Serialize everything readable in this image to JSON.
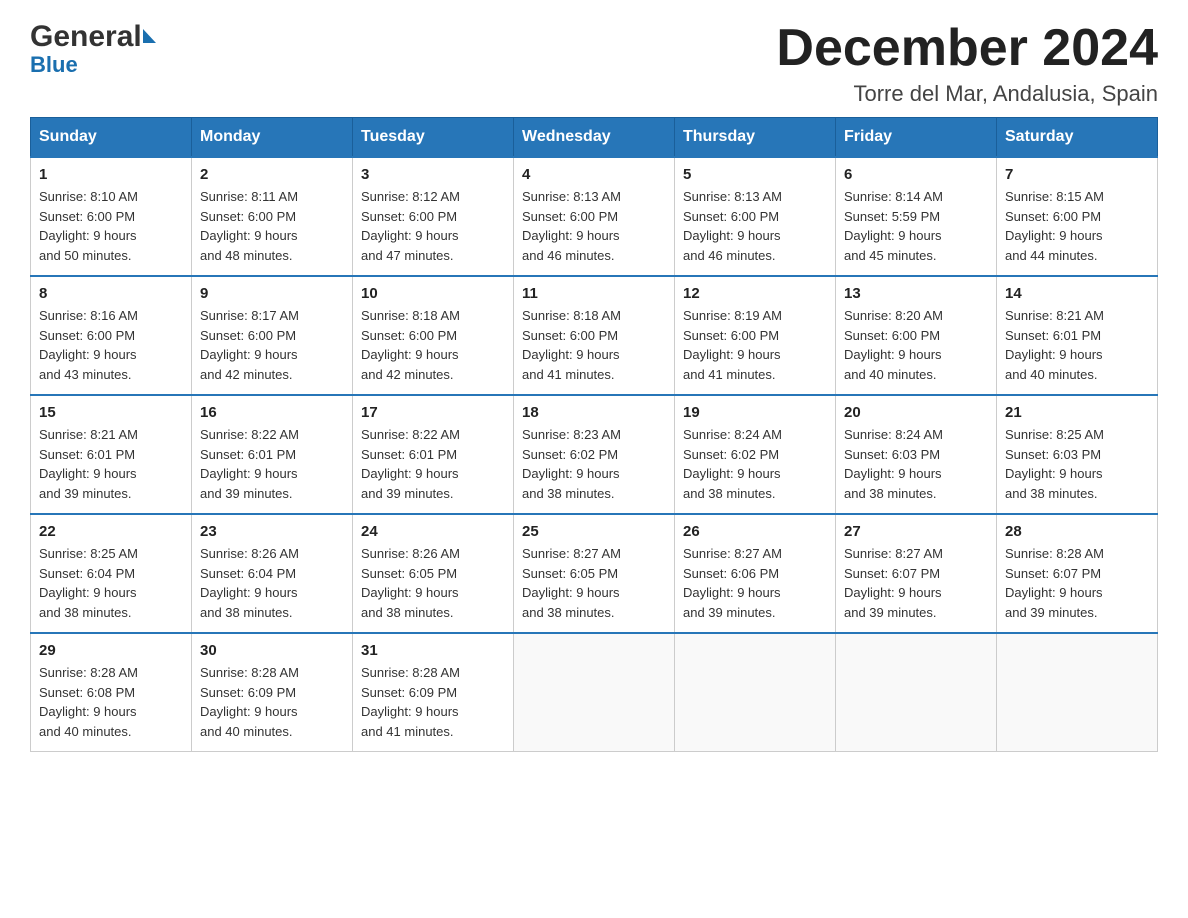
{
  "logo": {
    "general": "General",
    "blue": "Blue",
    "arrow": "▶"
  },
  "title": "December 2024",
  "subtitle": "Torre del Mar, Andalusia, Spain",
  "days_of_week": [
    "Sunday",
    "Monday",
    "Tuesday",
    "Wednesday",
    "Thursday",
    "Friday",
    "Saturday"
  ],
  "weeks": [
    [
      {
        "day": "1",
        "sunrise": "8:10 AM",
        "sunset": "6:00 PM",
        "daylight": "9 hours and 50 minutes."
      },
      {
        "day": "2",
        "sunrise": "8:11 AM",
        "sunset": "6:00 PM",
        "daylight": "9 hours and 48 minutes."
      },
      {
        "day": "3",
        "sunrise": "8:12 AM",
        "sunset": "6:00 PM",
        "daylight": "9 hours and 47 minutes."
      },
      {
        "day": "4",
        "sunrise": "8:13 AM",
        "sunset": "6:00 PM",
        "daylight": "9 hours and 46 minutes."
      },
      {
        "day": "5",
        "sunrise": "8:13 AM",
        "sunset": "6:00 PM",
        "daylight": "9 hours and 46 minutes."
      },
      {
        "day": "6",
        "sunrise": "8:14 AM",
        "sunset": "5:59 PM",
        "daylight": "9 hours and 45 minutes."
      },
      {
        "day": "7",
        "sunrise": "8:15 AM",
        "sunset": "6:00 PM",
        "daylight": "9 hours and 44 minutes."
      }
    ],
    [
      {
        "day": "8",
        "sunrise": "8:16 AM",
        "sunset": "6:00 PM",
        "daylight": "9 hours and 43 minutes."
      },
      {
        "day": "9",
        "sunrise": "8:17 AM",
        "sunset": "6:00 PM",
        "daylight": "9 hours and 42 minutes."
      },
      {
        "day": "10",
        "sunrise": "8:18 AM",
        "sunset": "6:00 PM",
        "daylight": "9 hours and 42 minutes."
      },
      {
        "day": "11",
        "sunrise": "8:18 AM",
        "sunset": "6:00 PM",
        "daylight": "9 hours and 41 minutes."
      },
      {
        "day": "12",
        "sunrise": "8:19 AM",
        "sunset": "6:00 PM",
        "daylight": "9 hours and 41 minutes."
      },
      {
        "day": "13",
        "sunrise": "8:20 AM",
        "sunset": "6:00 PM",
        "daylight": "9 hours and 40 minutes."
      },
      {
        "day": "14",
        "sunrise": "8:21 AM",
        "sunset": "6:01 PM",
        "daylight": "9 hours and 40 minutes."
      }
    ],
    [
      {
        "day": "15",
        "sunrise": "8:21 AM",
        "sunset": "6:01 PM",
        "daylight": "9 hours and 39 minutes."
      },
      {
        "day": "16",
        "sunrise": "8:22 AM",
        "sunset": "6:01 PM",
        "daylight": "9 hours and 39 minutes."
      },
      {
        "day": "17",
        "sunrise": "8:22 AM",
        "sunset": "6:01 PM",
        "daylight": "9 hours and 39 minutes."
      },
      {
        "day": "18",
        "sunrise": "8:23 AM",
        "sunset": "6:02 PM",
        "daylight": "9 hours and 38 minutes."
      },
      {
        "day": "19",
        "sunrise": "8:24 AM",
        "sunset": "6:02 PM",
        "daylight": "9 hours and 38 minutes."
      },
      {
        "day": "20",
        "sunrise": "8:24 AM",
        "sunset": "6:03 PM",
        "daylight": "9 hours and 38 minutes."
      },
      {
        "day": "21",
        "sunrise": "8:25 AM",
        "sunset": "6:03 PM",
        "daylight": "9 hours and 38 minutes."
      }
    ],
    [
      {
        "day": "22",
        "sunrise": "8:25 AM",
        "sunset": "6:04 PM",
        "daylight": "9 hours and 38 minutes."
      },
      {
        "day": "23",
        "sunrise": "8:26 AM",
        "sunset": "6:04 PM",
        "daylight": "9 hours and 38 minutes."
      },
      {
        "day": "24",
        "sunrise": "8:26 AM",
        "sunset": "6:05 PM",
        "daylight": "9 hours and 38 minutes."
      },
      {
        "day": "25",
        "sunrise": "8:27 AM",
        "sunset": "6:05 PM",
        "daylight": "9 hours and 38 minutes."
      },
      {
        "day": "26",
        "sunrise": "8:27 AM",
        "sunset": "6:06 PM",
        "daylight": "9 hours and 39 minutes."
      },
      {
        "day": "27",
        "sunrise": "8:27 AM",
        "sunset": "6:07 PM",
        "daylight": "9 hours and 39 minutes."
      },
      {
        "day": "28",
        "sunrise": "8:28 AM",
        "sunset": "6:07 PM",
        "daylight": "9 hours and 39 minutes."
      }
    ],
    [
      {
        "day": "29",
        "sunrise": "8:28 AM",
        "sunset": "6:08 PM",
        "daylight": "9 hours and 40 minutes."
      },
      {
        "day": "30",
        "sunrise": "8:28 AM",
        "sunset": "6:09 PM",
        "daylight": "9 hours and 40 minutes."
      },
      {
        "day": "31",
        "sunrise": "8:28 AM",
        "sunset": "6:09 PM",
        "daylight": "9 hours and 41 minutes."
      },
      null,
      null,
      null,
      null
    ]
  ],
  "labels": {
    "sunrise": "Sunrise:",
    "sunset": "Sunset:",
    "daylight": "Daylight:"
  }
}
